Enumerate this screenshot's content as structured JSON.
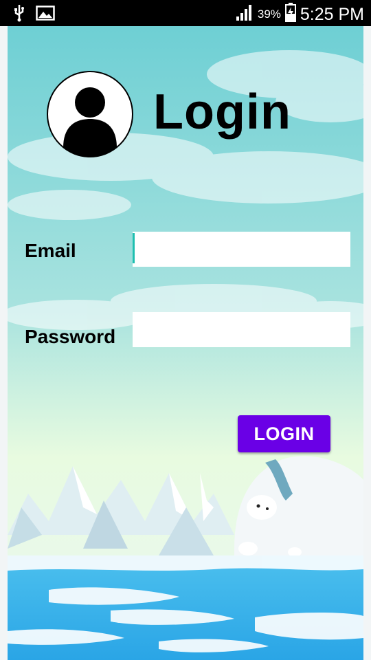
{
  "status_bar": {
    "battery_percent": "39%",
    "time": "5:25 PM",
    "icons": [
      "usb-icon",
      "image-icon",
      "signal-icon",
      "battery-charging-icon"
    ]
  },
  "login": {
    "title": "Login",
    "email_label": "Email",
    "email_value": "",
    "password_label": "Password",
    "password_value": "",
    "button_label": "LOGIN"
  },
  "colors": {
    "button": "#6a00e6",
    "cursor": "#1fbfb0",
    "sky_top": "#6ecfd4",
    "sky_bottom": "#e8fbe0"
  }
}
